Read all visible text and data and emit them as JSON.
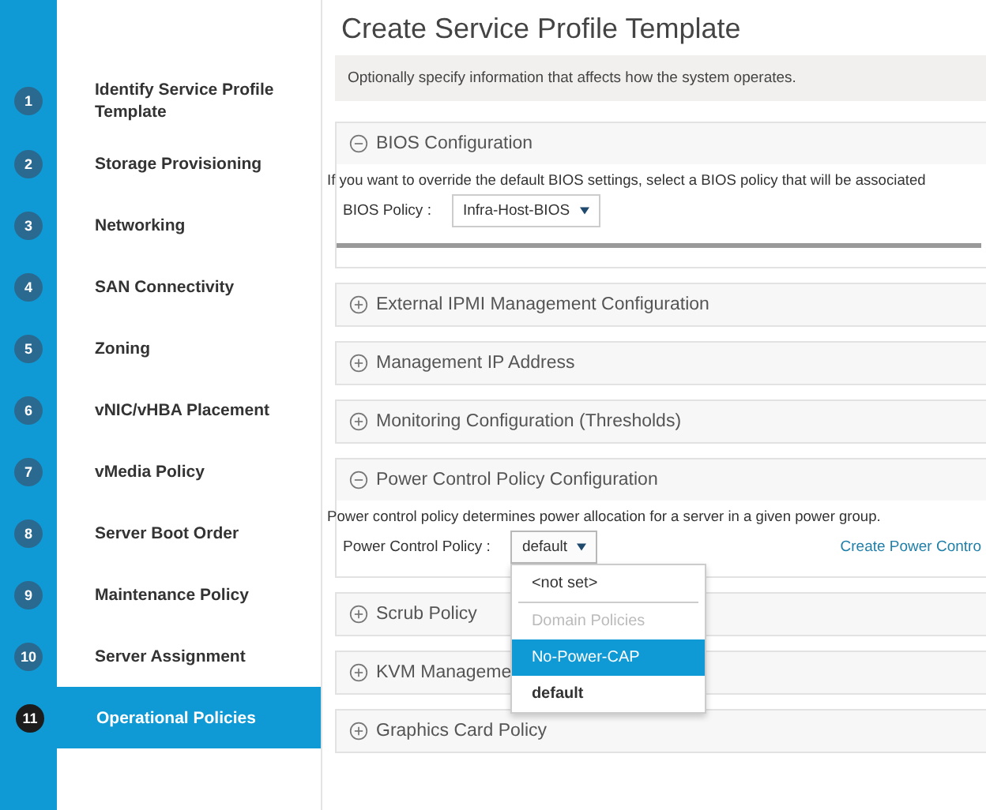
{
  "steps": [
    {
      "number": "1",
      "label": "Identify Service Profile Template",
      "selected": false
    },
    {
      "number": "2",
      "label": "Storage Provisioning",
      "selected": false
    },
    {
      "number": "3",
      "label": "Networking",
      "selected": false
    },
    {
      "number": "4",
      "label": "SAN Connectivity",
      "selected": false
    },
    {
      "number": "5",
      "label": "Zoning",
      "selected": false
    },
    {
      "number": "6",
      "label": "vNIC/vHBA Placement",
      "selected": false
    },
    {
      "number": "7",
      "label": "vMedia Policy",
      "selected": false
    },
    {
      "number": "8",
      "label": "Server Boot Order",
      "selected": false
    },
    {
      "number": "9",
      "label": "Maintenance Policy",
      "selected": false
    },
    {
      "number": "10",
      "label": "Server Assignment",
      "selected": false
    },
    {
      "number": "11",
      "label": "Operational Policies",
      "selected": true
    }
  ],
  "page": {
    "title": "Create Service Profile Template",
    "info": "Optionally specify information that affects how the system operates."
  },
  "sections": [
    {
      "title": "BIOS Configuration",
      "expanded": true,
      "description": "If you want to override the default BIOS settings, select a BIOS policy that will be associated",
      "field_label": "BIOS Policy :",
      "field_value": "Infra-Host-BIOS"
    },
    {
      "title": "External IPMI Management Configuration",
      "expanded": false
    },
    {
      "title": "Management IP Address",
      "expanded": false
    },
    {
      "title": "Monitoring Configuration (Thresholds)",
      "expanded": false
    },
    {
      "title": "Power Control Policy Configuration",
      "expanded": true,
      "description": "Power control policy determines power allocation for a server in a given power group.",
      "field_label": "Power Control Policy :",
      "field_value": "default",
      "link": "Create Power Contro",
      "dropdown_open": true
    },
    {
      "title": "Scrub Policy",
      "expanded": false
    },
    {
      "title": "KVM Manageme",
      "expanded": false
    },
    {
      "title": "Graphics Card Policy",
      "expanded": false
    }
  ],
  "dropdown": {
    "options": [
      {
        "kind": "option",
        "label": "<not set>",
        "selected": false
      },
      {
        "kind": "group",
        "label": "Domain Policies"
      },
      {
        "kind": "option",
        "label": "No-Power-CAP",
        "selected": true
      },
      {
        "kind": "current",
        "label": "default",
        "selected": false
      }
    ]
  }
}
